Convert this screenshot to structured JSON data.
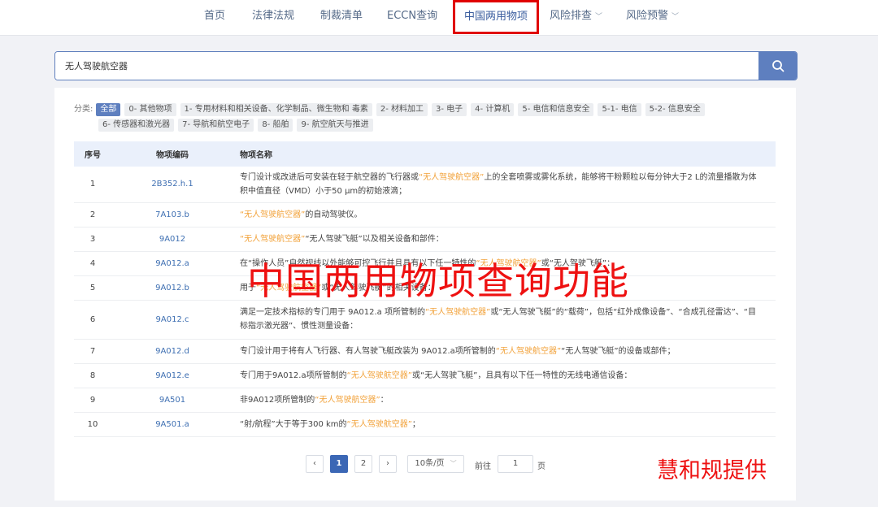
{
  "nav": {
    "items": [
      "首页",
      "法律法规",
      "制裁清单",
      "ECCN查询"
    ],
    "active": "中国两用物项",
    "dropdowns": [
      "风险排查",
      "风险预警"
    ]
  },
  "search": {
    "value": "无人驾驶航空器",
    "button_icon": "search-icon"
  },
  "categories": {
    "label": "分类:",
    "row1": [
      "全部",
      "0- 其他物项",
      "1- 专用材料和相关设备、化学制品、微生物和 毒素",
      "2- 材料加工",
      "3- 电子",
      "4- 计算机",
      "5- 电信和信息安全",
      "5-1- 电信",
      "5-2- 信息安全"
    ],
    "row2": [
      "6- 传感器和激光器",
      "7- 导航和航空电子",
      "8- 船舶",
      "9- 航空航天与推进"
    ]
  },
  "table": {
    "headers": [
      "序号",
      "物项编码",
      "物项名称"
    ],
    "rows": [
      {
        "no": "1",
        "code": "2B352.h.1",
        "parts": [
          "专门设计或改进后可安装在轻于航空器的飞行器或",
          "“无人驾驶航空器”",
          "上的全套喷雾或雾化系统，能够将干粉颗粒以每分钟大于2 L的流量播散为体积中值直径（VMD）小于50 μm的初始液滴；"
        ]
      },
      {
        "no": "2",
        "code": "7A103.b",
        "parts": [
          "",
          "“无人驾驶航空器”",
          "的自动驾驶仪。"
        ]
      },
      {
        "no": "3",
        "code": "9A012",
        "parts": [
          "",
          "“无人驾驶航空器”",
          "“无人驾驶飞艇”以及相关设备和部件："
        ]
      },
      {
        "no": "4",
        "code": "9A012.a",
        "parts": [
          "在“操作人员”自然视线以外能够可控飞行并且具有以下任一特性的",
          "“无人驾驶航空器”",
          "或“无人驾驶飞艇”："
        ]
      },
      {
        "no": "5",
        "code": "9A012.b",
        "parts": [
          "用于",
          "“无人驾驶航空器”",
          "或“无人驾驶飞艇”的相关设备："
        ]
      },
      {
        "no": "6",
        "code": "9A012.c",
        "parts": [
          "满足一定技术指标的专门用于 9A012.a 项所管制的",
          "“无人驾驶航空器”",
          "或“无人驾驶飞艇”的“载荷”，包括“红外成像设备”、“合成孔径雷达”、“目标指示激光器”、惯性测量设备："
        ]
      },
      {
        "no": "7",
        "code": "9A012.d",
        "parts": [
          "专门设计用于将有人飞行器、有人驾驶飞艇改装为 9A012.a项所管制的",
          "“无人驾驶航空器”",
          "“无人驾驶飞艇”的设备或部件；"
        ]
      },
      {
        "no": "8",
        "code": "9A012.e",
        "parts": [
          "专门用于9A012.a项所管制的",
          "“无人驾驶航空器”",
          "或“无人驾驶飞艇”，且具有以下任一特性的无线电通信设备："
        ]
      },
      {
        "no": "9",
        "code": "9A501",
        "parts": [
          "非9A012项所管制的",
          "“无人驾驶航空器”",
          "："
        ]
      },
      {
        "no": "10",
        "code": "9A501.a",
        "parts": [
          "“射/航程”大于等于300 km的",
          "“无人驾驶航空器”",
          "；"
        ]
      }
    ]
  },
  "pagination": {
    "prev": "‹",
    "next": "›",
    "pages": [
      "1",
      "2"
    ],
    "current": "1",
    "page_size": "10条/页",
    "goto_label": "前往",
    "goto_value": "1",
    "page_unit": "页"
  },
  "overlay": {
    "title": "中国两用物项查询功能",
    "credit": "慧和规提供"
  },
  "colors": {
    "accent": "#5e7fbf",
    "highlight": "#f2a33c",
    "annotation": "#ee1111"
  }
}
